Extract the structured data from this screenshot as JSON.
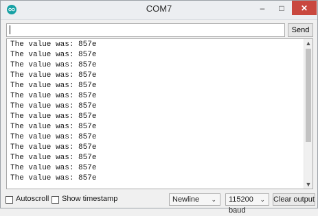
{
  "window": {
    "title": "COM7",
    "controls": {
      "minimize": "–",
      "maximize": "□",
      "close": "✕"
    },
    "accent": "#c9483f",
    "icon": "arduino-icon"
  },
  "send_bar": {
    "input_value": "",
    "send_label": "Send"
  },
  "output": {
    "lines": [
      "The value was: 857e",
      "The value was: 857e",
      "The value was: 857e",
      "The value was: 857e",
      "The value was: 857e",
      "The value was: 857e",
      "The value was: 857e",
      "The value was: 857e",
      "The value was: 857e",
      "The value was: 857e",
      "The value was: 857e",
      "The value was: 857e",
      "The value was: 857e",
      "The value was: 857e"
    ]
  },
  "bottom_bar": {
    "autoscroll_label": "Autoscroll",
    "autoscroll_checked": false,
    "timestamp_label": "Show timestamp",
    "timestamp_checked": false,
    "line_ending": "Newline",
    "baud_rate": "115200 baud",
    "clear_label": "Clear output"
  }
}
